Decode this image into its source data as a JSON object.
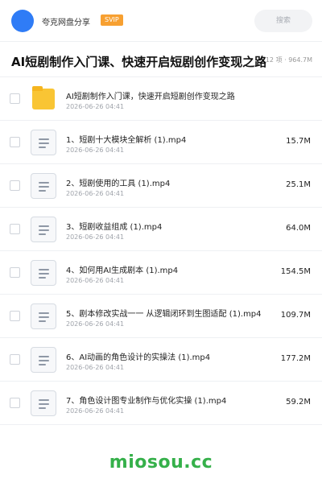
{
  "header": {
    "username": "夸克网盘分享",
    "badge": "SVIP",
    "search_placeholder": "搜索"
  },
  "folder_title": "AI短剧制作入门课、快速开启短剧创作变现之路",
  "meta": "12 项 · 964.7M",
  "items": [
    {
      "type": "folder",
      "icon": "folder-icon",
      "name": "AI短剧制作入门课，快速开启短剧创作变现之路",
      "date": "2026-06-26 04:41",
      "size": ""
    },
    {
      "type": "file",
      "icon": "video-file-icon",
      "name": "1、短剧十大模块全解析 (1).mp4",
      "date": "2026-06-26 04:41",
      "size": "15.7M"
    },
    {
      "type": "file",
      "icon": "video-file-icon",
      "name": "2、短剧使用的工具 (1).mp4",
      "date": "2026-06-26 04:41",
      "size": "25.1M"
    },
    {
      "type": "file",
      "icon": "video-file-icon",
      "name": "3、短剧收益组成 (1).mp4",
      "date": "2026-06-26 04:41",
      "size": "64.0M"
    },
    {
      "type": "file",
      "icon": "video-file-icon",
      "name": "4、如何用AI生成剧本 (1).mp4",
      "date": "2026-06-26 04:41",
      "size": "154.5M"
    },
    {
      "type": "file",
      "icon": "video-file-icon",
      "name": "5、剧本修改实战一一 从逻辑闭环到生图适配 (1).mp4",
      "date": "2026-06-26 04:41",
      "size": "109.7M"
    },
    {
      "type": "file",
      "icon": "video-file-icon",
      "name": "6、AI动画的角色设计的实操法 (1).mp4",
      "date": "2026-06-26 04:41",
      "size": "177.2M"
    },
    {
      "type": "file",
      "icon": "video-file-icon",
      "name": "7、角色设计图专业制作与优化实操 (1).mp4",
      "date": "2026-06-26 04:41",
      "size": "59.2M"
    }
  ],
  "watermark": "miosou.cc",
  "colors": {
    "accent": "#2f7cf6",
    "badge": "#f7a031",
    "folder": "#f9c534",
    "watermark": "#35b04a"
  }
}
